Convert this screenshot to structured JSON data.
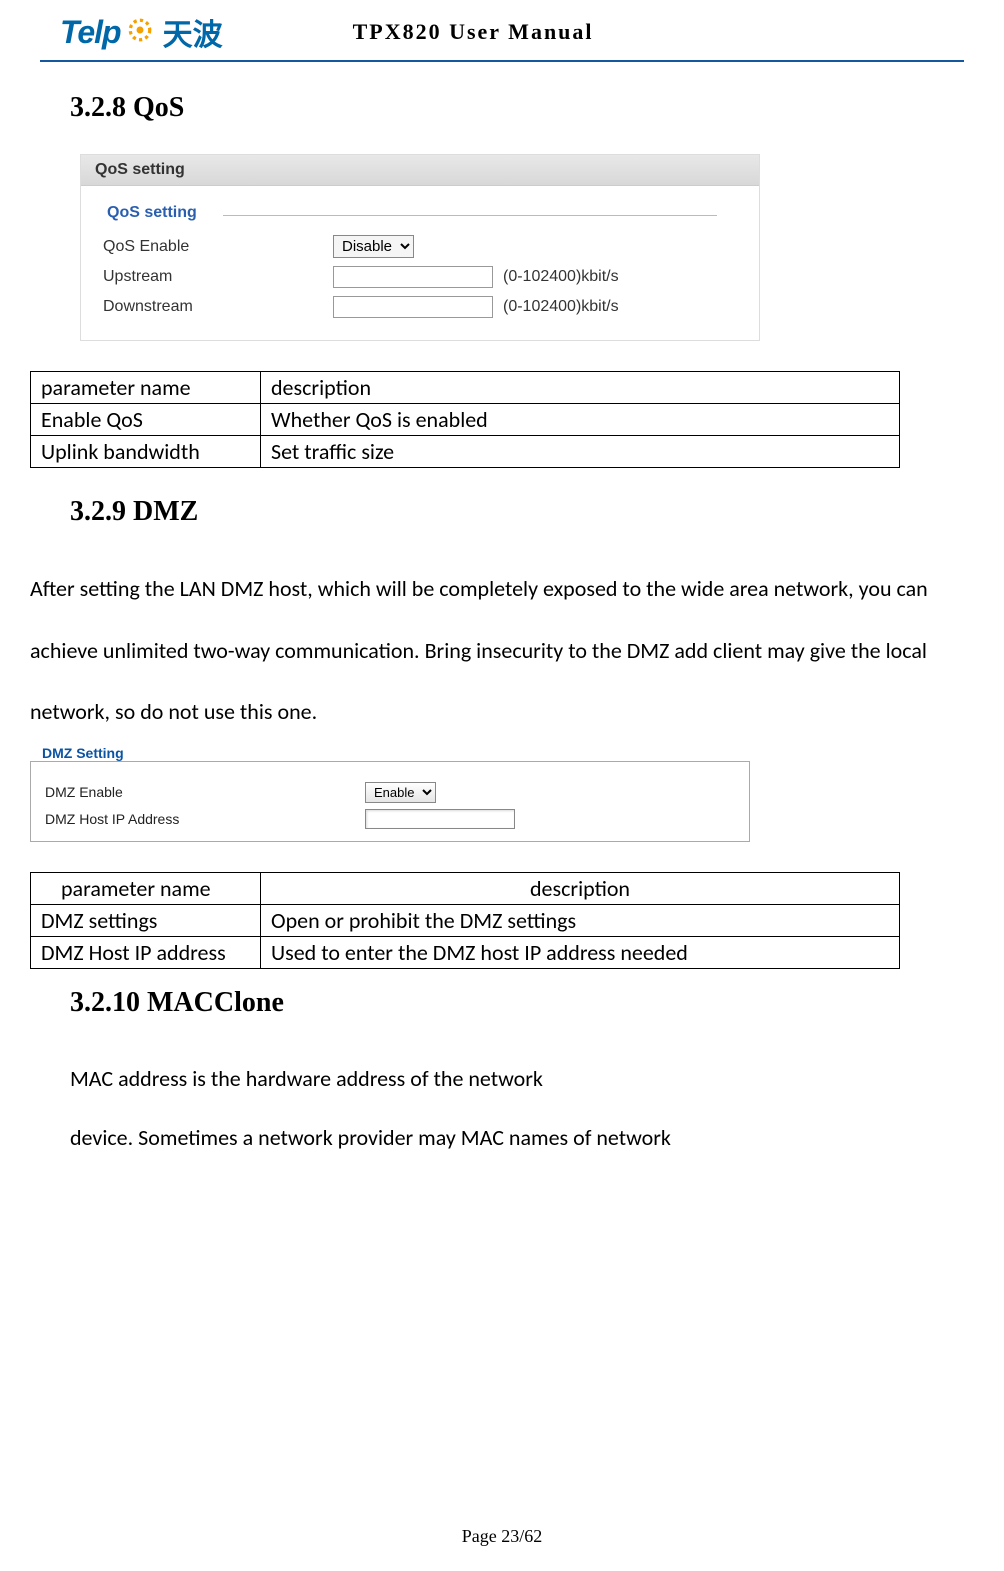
{
  "header": {
    "logo_text": "Telp",
    "logo_cn": "天波",
    "title": "TPX820 User Manual"
  },
  "sections": {
    "s1": {
      "title": "3.2.8 QoS"
    },
    "s2": {
      "title": "3.2.9 DMZ",
      "paragraph": "After setting the LAN DMZ host, which will be completely exposed to the wide area network, you can achieve unlimited two-way communication. Bring insecurity to the DMZ add client may give the local network, so do not use this one."
    },
    "s3": {
      "title": "3.2.10 MACClone",
      "p1": "MAC address is the hardware address of the network",
      "p2": "device. Sometimes a network provider may MAC names of network"
    }
  },
  "qos_shot": {
    "titlebar": "QoS setting",
    "legend": "QoS setting",
    "rows": {
      "enable_label": "QoS Enable",
      "enable_value": "Disable",
      "upstream_label": "Upstream",
      "downstream_label": "Downstream",
      "unit": "(0-102400)kbit/s"
    }
  },
  "table1": {
    "h1": "parameter name",
    "h2": "description",
    "r1c1": "Enable QoS",
    "r1c2": "Whether QoS is enabled",
    "r2c1": "Uplink bandwidth",
    "r2c2": "Set traffic size"
  },
  "dmz_shot": {
    "legend": "DMZ Setting",
    "enable_label": "DMZ Enable",
    "enable_value": "Enable",
    "host_label": "DMZ Host IP Address"
  },
  "table2": {
    "h1": "parameter name",
    "h2": "description",
    "r1c1": "DMZ settings",
    "r1c2": "Open or prohibit the DMZ settings",
    "r2c1": "DMZ Host IP address",
    "r2c2": "Used to enter the DMZ host IP address needed"
  },
  "footer": "Page 23/62"
}
